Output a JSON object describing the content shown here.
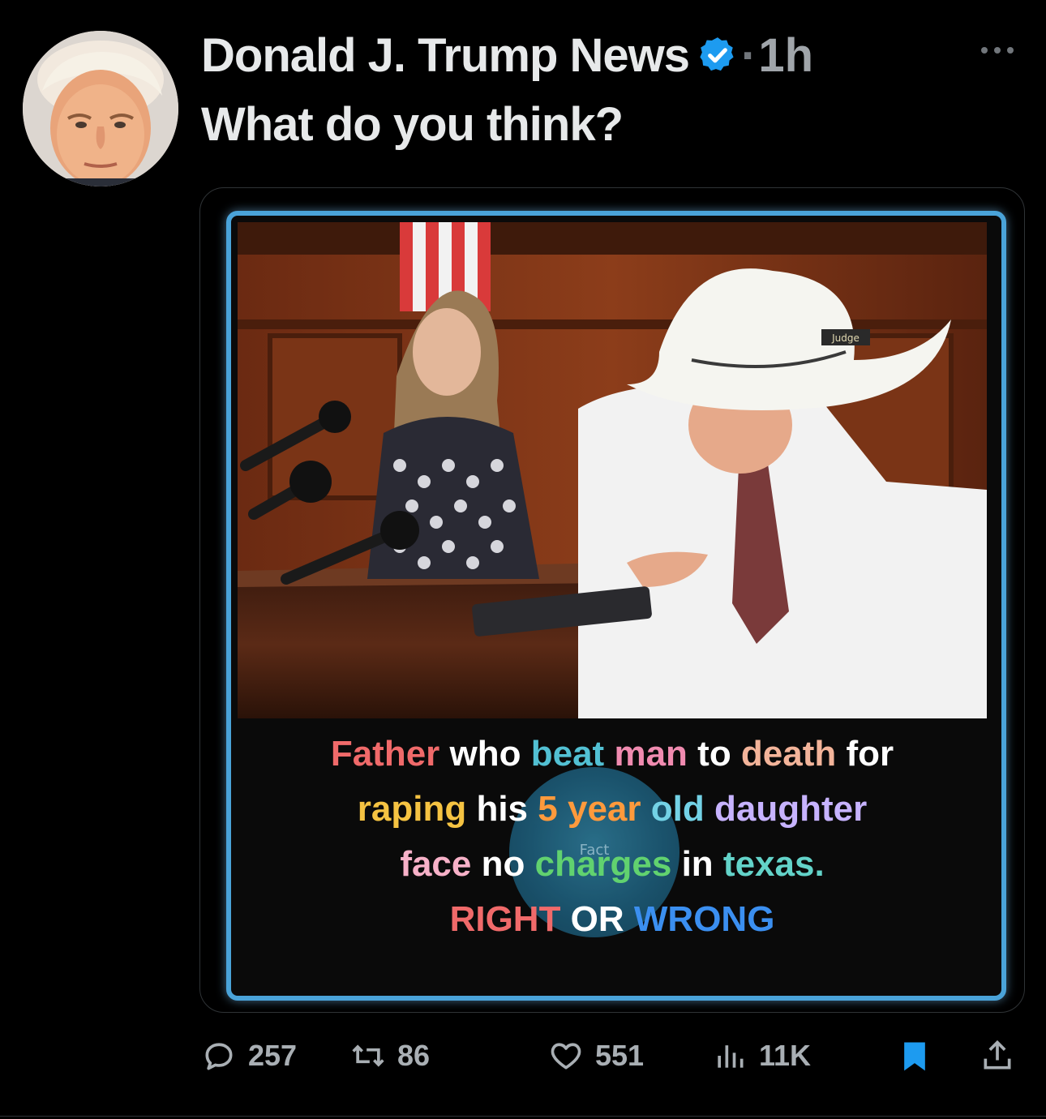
{
  "post": {
    "author_name": "Donald J. Trump News",
    "separator": "·",
    "time_ago": "1h",
    "text": "What do you think?",
    "verified_color": "#1d9bf0"
  },
  "media": {
    "desk_sign": "Judge",
    "watermark": "Fact",
    "caption": {
      "line1": [
        {
          "t": "Father",
          "c": "red"
        },
        {
          "t": " who ",
          "c": "white"
        },
        {
          "t": "beat",
          "c": "teal"
        },
        {
          "t": " ",
          "c": "white"
        },
        {
          "t": "man",
          "c": "pink"
        },
        {
          "t": " to ",
          "c": "white"
        },
        {
          "t": "death",
          "c": "peach"
        },
        {
          "t": " for",
          "c": "white"
        }
      ],
      "line2": [
        {
          "t": "raping",
          "c": "yellow"
        },
        {
          "t": " his ",
          "c": "white"
        },
        {
          "t": "5",
          "c": "orange"
        },
        {
          "t": " ",
          "c": "white"
        },
        {
          "t": "year",
          "c": "orange"
        },
        {
          "t": " ",
          "c": "white"
        },
        {
          "t": "old",
          "c": "cyan"
        },
        {
          "t": " daughter",
          "c": "lilac"
        }
      ],
      "line3": [
        {
          "t": "face",
          "c": "lpink"
        },
        {
          "t": " no ",
          "c": "white"
        },
        {
          "t": "charges",
          "c": "green"
        },
        {
          "t": " in ",
          "c": "white"
        },
        {
          "t": "texas.",
          "c": "lteal"
        }
      ],
      "line4": [
        {
          "t": "RIGHT",
          "c": "red"
        },
        {
          "t": " OR ",
          "c": "white"
        },
        {
          "t": "WRONG",
          "c": "blue"
        }
      ]
    }
  },
  "actions": {
    "replies": "257",
    "reposts": "86",
    "likes": "551",
    "views": "11K",
    "bookmark_color": "#1d9bf0",
    "icons": [
      "reply-icon",
      "repost-icon",
      "like-icon",
      "views-icon",
      "bookmark-icon",
      "share-icon"
    ]
  }
}
